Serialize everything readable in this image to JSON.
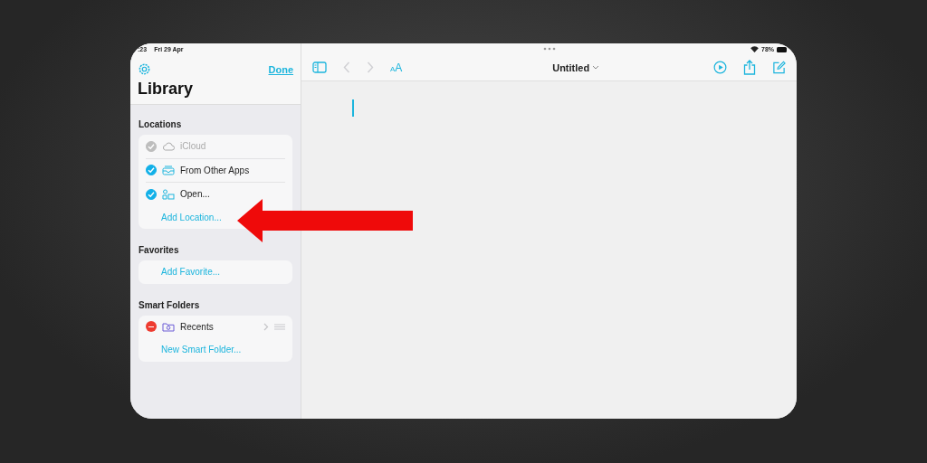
{
  "status_bar": {
    "time": ":23",
    "date": "Fri 29 Apr",
    "battery": "78%"
  },
  "sidebar": {
    "done": "Done",
    "title": "Library",
    "sections": [
      {
        "title": "Locations",
        "items": [
          {
            "kind": "location",
            "label": "iCloud",
            "checked": true,
            "disabled": true
          },
          {
            "kind": "location",
            "label": "From Other Apps",
            "checked": true,
            "disabled": false
          },
          {
            "kind": "location",
            "label": "Open...",
            "checked": true,
            "disabled": false
          },
          {
            "kind": "add",
            "label": "Add Location..."
          }
        ]
      },
      {
        "title": "Favorites",
        "items": [
          {
            "kind": "add",
            "label": "Add Favorite..."
          }
        ]
      },
      {
        "title": "Smart Folders",
        "items": [
          {
            "kind": "smart_folder",
            "label": "Recents"
          },
          {
            "kind": "add",
            "label": "New Smart Folder..."
          }
        ]
      }
    ]
  },
  "toolbar": {
    "font_button": "AA",
    "title": "Untitled",
    "back_disabled": true,
    "forward_disabled": true
  }
}
